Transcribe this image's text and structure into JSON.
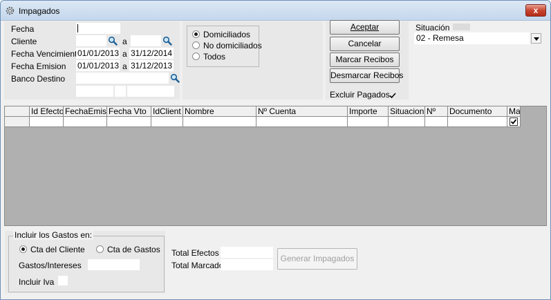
{
  "window": {
    "title": "Impagados",
    "close_label": "x"
  },
  "filters": {
    "fecha_label": "Fecha",
    "fecha_value": "",
    "cliente_label": "Cliente",
    "cliente_from": "",
    "cliente_to": "",
    "a_label": "a",
    "vencimiento_label": "Fecha Vencimiento",
    "vencimiento_from": "01/01/2013",
    "vencimiento_to": "31/12/2014",
    "emision_label": "Fecha Emision",
    "emision_from": "01/01/2013",
    "emision_to": "31/12/2013",
    "banco_label": "Banco Destino",
    "banco_value": ""
  },
  "tipo": {
    "options": [
      "Domiciliados",
      "No domiciliados",
      "Todos"
    ],
    "selected": "Domiciliados"
  },
  "actions": {
    "aceptar": "Aceptar",
    "cancelar": "Cancelar",
    "marcar": "Marcar Recibos",
    "desmarcar": "Desmarcar Recibos",
    "excluir_label": "Excluir Pagados",
    "excluir_checked": true
  },
  "situacion": {
    "label": "Situación",
    "value": "02 - Remesa"
  },
  "grid": {
    "columns": [
      "Id Efecto",
      "FechaEmisi",
      "Fecha Vto",
      "IdClient",
      "Nombre",
      "Nº Cuenta",
      "Importe",
      "Situacion",
      "Nº",
      "Documento",
      "Ma"
    ],
    "row_marked": true
  },
  "gastos": {
    "legend": "Incluir los Gastos en:",
    "options": [
      "Cta del Cliente",
      "Cta de Gastos"
    ],
    "selected": "Cta del Cliente",
    "gastos_label": "Gastos/Intereses",
    "gastos_value": "",
    "iva_label": "Incluir Iva",
    "iva_checked": false
  },
  "totals": {
    "efectos_label": "Total Efectos",
    "efectos_value": "",
    "marcado_label": "Total Marcado",
    "marcado_value": ""
  },
  "generar_label": "Generar Impagados",
  "icons": {
    "app": "gear-icon",
    "search": "magnifier-icon",
    "check": "checkmark-icon",
    "dropdown": "chevron-down-icon"
  }
}
